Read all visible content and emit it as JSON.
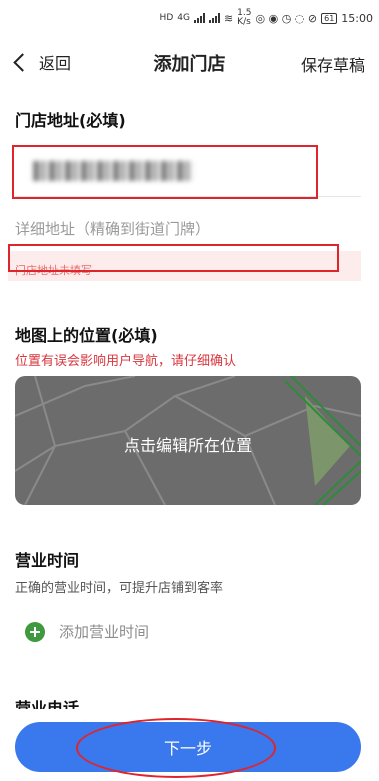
{
  "status_bar": {
    "hd_badge": "HD",
    "signal_label": "4G",
    "net_speed": "1.5",
    "net_unit": "K/s",
    "battery": "61",
    "time": "15:00"
  },
  "nav": {
    "back_label": "返回",
    "title": "添加门店",
    "save_draft_label": "保存草稿"
  },
  "address_section": {
    "title": "门店地址(必填)",
    "detail_placeholder": "详细地址（精确到街道门牌）",
    "error_text": "门店地址未填写"
  },
  "map_section": {
    "title": "地图上的位置(必填)",
    "warning": "位置有误会影响用户导航，请仔细确认",
    "edit_label": "点击编辑所在位置"
  },
  "hours_section": {
    "title": "营业时间",
    "subtitle": "正确的营业时间，可提升店铺到客率",
    "add_label": "添加营业时间"
  },
  "phone_section": {
    "title": "营业电话"
  },
  "footer": {
    "next_label": "下一步"
  },
  "colors": {
    "accent": "#3a78ee",
    "warning": "#d9363e",
    "annotation": "#e0242b",
    "add_icon": "#3f9a3f"
  },
  "icons": [
    "back-chevron-icon",
    "add-circle-icon"
  ]
}
